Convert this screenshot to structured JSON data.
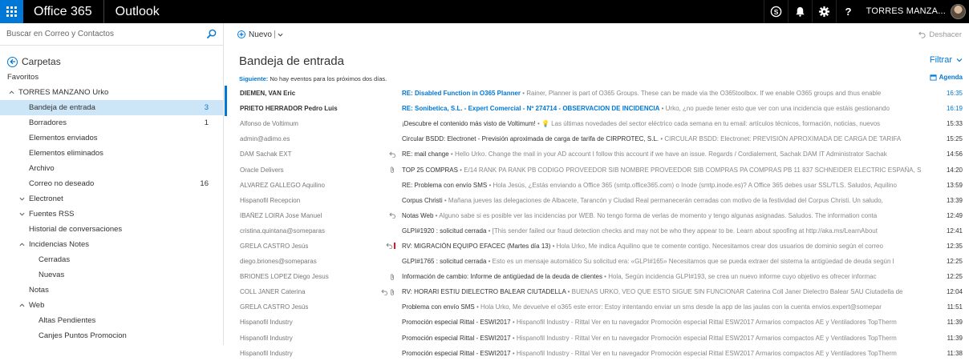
{
  "suite": {
    "brand": "Office 365",
    "app": "Outlook",
    "user_name": "TORRES MANZA..."
  },
  "search": {
    "placeholder": "Buscar en Correo y Contactos"
  },
  "nav": {
    "folders_label": "Carpetas",
    "favorites_label": "Favoritos",
    "account_label": "TORRES MANZANO Urko",
    "items": [
      {
        "label": "Bandeja de entrada",
        "count": "3"
      },
      {
        "label": "Borradores",
        "count": "1"
      },
      {
        "label": "Elementos enviados",
        "count": ""
      },
      {
        "label": "Elementos eliminados",
        "count": ""
      },
      {
        "label": "Archivo",
        "count": ""
      },
      {
        "label": "Correo no deseado",
        "count": "16"
      },
      {
        "label": "Electronet",
        "count": ""
      },
      {
        "label": "Fuentes RSS",
        "count": ""
      },
      {
        "label": "Historial de conversaciones",
        "count": ""
      },
      {
        "label": "Incidencias Notes",
        "count": ""
      },
      {
        "label": "Cerradas",
        "count": ""
      },
      {
        "label": "Nuevas",
        "count": ""
      },
      {
        "label": "Notas",
        "count": ""
      },
      {
        "label": "Web",
        "count": ""
      },
      {
        "label": "Altas Pendientes",
        "count": ""
      },
      {
        "label": "Canjes Puntos Promocion",
        "count": ""
      }
    ]
  },
  "toolbar": {
    "new_label": "Nuevo",
    "undo_label": "Deshacer"
  },
  "inbox": {
    "title": "Bandeja de entrada",
    "filter_label": "Filtrar",
    "next_label": "Siguiente:",
    "next_text": "No hay eventos para los próximos dos días.",
    "agenda_label": "Agenda"
  },
  "colors": {
    "accent": "#0078d7",
    "selected_bg": "#cde6f7",
    "suite_bar": "#000000"
  },
  "messages": [
    {
      "from": "DIEMEN, VAN Eric",
      "subject": "RE: Disabled Function in O365 Planner",
      "preview": " • Rainer,  Planner is part of O365 Groups.  These can be made via the O365toolbox.  If we enable O365 groups and thus enable",
      "time": "16:35",
      "unread": true
    },
    {
      "from": "PRIETO HERRADOR Pedro Luis",
      "subject": "RE: Sonibetica, S.L. - Expert Comercial - Nº 274714 - OBSERVACION DE INCIDENCIA",
      "preview": " • Urko, ¿no puede tener esto que ver con una incidencia que estáis gestionando",
      "time": "16:19",
      "unread": true
    },
    {
      "from": "Alfonso de Voltimum",
      "subject": "¡Descubre el contenido más visto de Voltimum!",
      "preview": " • 💡 Las últimas novedades del sector eléctrico cada semana en tu email: artículos técnicos, formación, noticias, nuevos",
      "time": "15:33",
      "unread": false
    },
    {
      "from": "admin@adimo.es",
      "subject": "Circular BSDD: Electronet - Previsión aproximada de carga de tarifa de CIRPROTEC, S.L.",
      "preview": " • CIRCULAR BSDD: Electronet: PREVISIÓN APROXIMADA DE CARGA DE TARIFA",
      "time": "15:25",
      "unread": false
    },
    {
      "from": "DAM Sachak EXT",
      "subject": "RE: mail change",
      "preview": " • Hello Urko. Change the mail in your AD account I follow this account if we have an issue. Regards / Cordialement,   Sachak DAM IT Administrator Sachak",
      "time": "14:56",
      "unread": false,
      "reply": true
    },
    {
      "from": "Oracle Delivers",
      "subject": "TOP 25 COMPRAS",
      "preview": " • E/14   RANK PA RANK PB CODIGO PROVEEDOR SIB NOMBRE PROVEEDOR SIB COMPRAS PA COMPRAS PB 11 837 SCHNEIDER ELECTRIC ESPAÑA, S.A.",
      "time": "14:20",
      "unread": false,
      "attach": true
    },
    {
      "from": "ALVAREZ GALLEGO Aquilino",
      "subject": "RE: Problema con envío SMS",
      "preview": " • Hola Jesús,  ¿Estás enviando a Office 365 (smtp.office365.com) o Inode (smtp.inode.es)?  A Office 365 debes usar SSL/TLS.  Saludos, Aquilino",
      "time": "13:59",
      "unread": false
    },
    {
      "from": "Hispanofil Recepcion",
      "subject": "Corpus Christi",
      "preview": " • Mañana jueves las delegaciones de Albacete, Tarancón y Ciudad Real permanecerán cerradas con motivo de la festividad del Corpus Christi.  Un saludo,",
      "time": "13:39",
      "unread": false
    },
    {
      "from": "IBAÑEZ LOIRA Jose Manuel",
      "subject": "Notas Web",
      "preview": " • Alguno sabe si es posible ver las incidencias por WEB.  No tengo forma de verlas de momento y tengo algunas asignadas.  Saludos.  The information conta",
      "time": "12:49",
      "unread": false,
      "reply": true
    },
    {
      "from": "cristina.quintana@someparas",
      "subject": "GLPI#1920 : solicitud cerrada",
      "preview": " • [This sender failed our fraud detection checks and may not be who they appear to be. Learn about spoofing at http://aka.ms/LearnAbout",
      "time": "12:41",
      "unread": false
    },
    {
      "from": "GRELA CASTRO Jesús",
      "subject": "RV: MIGRACIÓN EQUIPO EFACEC (Martes día 13)",
      "preview": " • Hola Urko,   Me indica Aquilino que te comente contigo.  Necesitamos crear dos usuarios de dominio según el correo",
      "time": "12:35",
      "unread": false,
      "reply": true,
      "flag": true
    },
    {
      "from": "diego.briones@someparas",
      "subject": "GLPI#1765 : solicitud cerrada",
      "preview": " • Esto es un mensaje automático Su solicitud era: «GLPI#165» Necesitamos que se pueda extraer del sistema la antigüedad de deuda según l",
      "time": "12:25",
      "unread": false
    },
    {
      "from": "BRIONES LOPEZ Diego Jesus",
      "subject": "Información de cambio: Informe de antigüedad de la deuda de clientes",
      "preview": " • Hola,  Según incidencia GLPI#193, se crea un nuevo informe cuyo objetivo es ofrecer informac",
      "time": "12:25",
      "unread": false,
      "attach": true
    },
    {
      "from": "COLL JANER Caterina",
      "subject": "RV: HORARI ESTIU DIELECTRO BALEAR CIUTADELLA",
      "preview": " • BUENAS URKO, VEO QUE ESTO SIGUE SIN FUNCIONAR   Caterina Coll Janer  Dielectro Balear SAU  Ciutadella de",
      "time": "12:04",
      "unread": false,
      "reply": true,
      "attach": true
    },
    {
      "from": "GRELA CASTRO Jesús",
      "subject": "Problema con envío SMS",
      "preview": " • Hola Urko,    Me devuelve el o365 este error:  Estoy intentando enviar un sms desde la app de las jaulas con la cuenta envios.expert@somepar",
      "time": "11:51",
      "unread": false
    },
    {
      "from": "Hispanofil Industry",
      "subject": "Promoción especial Rittal - ESWI2017",
      "preview": " • Hispanofil Industry - Rittal Ver en tu navegador     Promoción especial Rittal ESW2017 Armarios compactos AE y Ventiladores TopTherm",
      "time": "11:39",
      "unread": false
    },
    {
      "from": "Hispanofil Industry",
      "subject": "Promoción especial Rittal - ESWI2017",
      "preview": " • Hispanofil Industry - Rittal Ver en tu navegador     Promoción especial Rittal ESW2017 Armarios compactos AE y Ventiladores TopTherm",
      "time": "11:39",
      "unread": false
    },
    {
      "from": "Hispanofil Industry",
      "subject": "Promoción especial Rittal - ESWI2017",
      "preview": " • Hispanofil Industry - Rittal Ver en tu navegador     Promoción especial Rittal ESW2017 Armarios compactos AE y Ventiladores TopTherm",
      "time": "11:38",
      "unread": false
    }
  ]
}
